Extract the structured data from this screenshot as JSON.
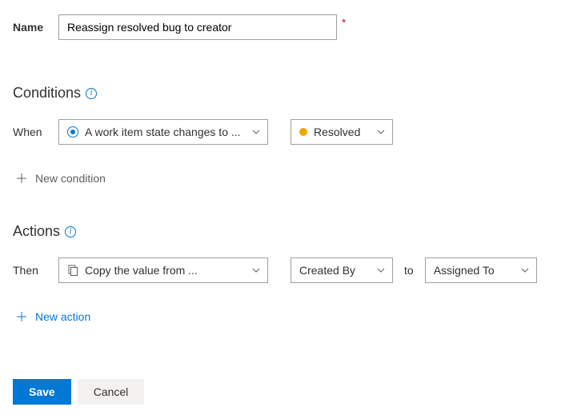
{
  "name_row": {
    "label": "Name",
    "value": "Reassign resolved bug to creator"
  },
  "conditions": {
    "title": "Conditions",
    "when_label": "When",
    "trigger": "A work item state changes to ...",
    "state": "Resolved",
    "add_label": "New condition"
  },
  "actions": {
    "title": "Actions",
    "then_label": "Then",
    "operation": "Copy the value from ...",
    "from_field": "Created By",
    "to_connector": "to",
    "to_field": "Assigned To",
    "add_label": "New action"
  },
  "footer": {
    "save": "Save",
    "cancel": "Cancel"
  }
}
